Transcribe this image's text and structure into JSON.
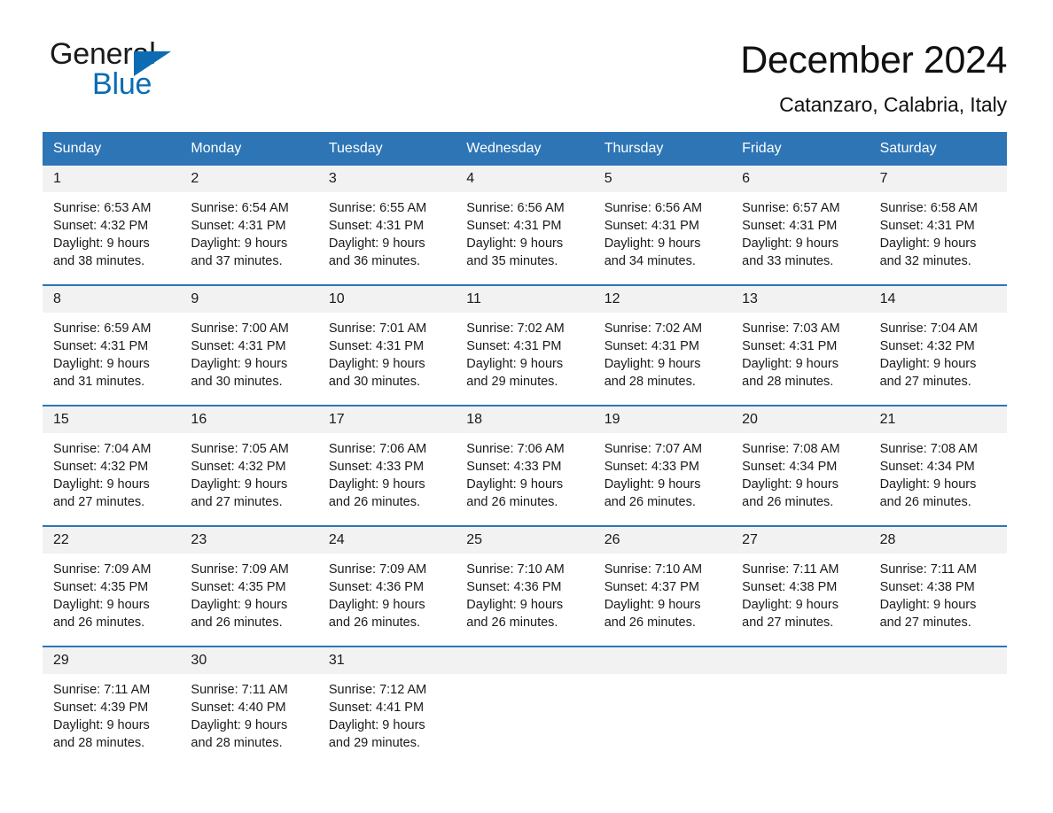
{
  "brand": {
    "name_top": "General",
    "name_bottom": "Blue",
    "accent_color": "#0b6cb3"
  },
  "header": {
    "title": "December 2024",
    "subtitle": "Catanzaro, Calabria, Italy"
  },
  "theme": {
    "header_blue": "#2e75b6",
    "daynum_bg": "#f2f2f2",
    "text": "#1a1a1a"
  },
  "weekdays": [
    "Sunday",
    "Monday",
    "Tuesday",
    "Wednesday",
    "Thursday",
    "Friday",
    "Saturday"
  ],
  "weeks": [
    [
      {
        "day": "1",
        "sunrise": "Sunrise: 6:53 AM",
        "sunset": "Sunset: 4:32 PM",
        "daylight_line1": "Daylight: 9 hours",
        "daylight_line2": "and 38 minutes."
      },
      {
        "day": "2",
        "sunrise": "Sunrise: 6:54 AM",
        "sunset": "Sunset: 4:31 PM",
        "daylight_line1": "Daylight: 9 hours",
        "daylight_line2": "and 37 minutes."
      },
      {
        "day": "3",
        "sunrise": "Sunrise: 6:55 AM",
        "sunset": "Sunset: 4:31 PM",
        "daylight_line1": "Daylight: 9 hours",
        "daylight_line2": "and 36 minutes."
      },
      {
        "day": "4",
        "sunrise": "Sunrise: 6:56 AM",
        "sunset": "Sunset: 4:31 PM",
        "daylight_line1": "Daylight: 9 hours",
        "daylight_line2": "and 35 minutes."
      },
      {
        "day": "5",
        "sunrise": "Sunrise: 6:56 AM",
        "sunset": "Sunset: 4:31 PM",
        "daylight_line1": "Daylight: 9 hours",
        "daylight_line2": "and 34 minutes."
      },
      {
        "day": "6",
        "sunrise": "Sunrise: 6:57 AM",
        "sunset": "Sunset: 4:31 PM",
        "daylight_line1": "Daylight: 9 hours",
        "daylight_line2": "and 33 minutes."
      },
      {
        "day": "7",
        "sunrise": "Sunrise: 6:58 AM",
        "sunset": "Sunset: 4:31 PM",
        "daylight_line1": "Daylight: 9 hours",
        "daylight_line2": "and 32 minutes."
      }
    ],
    [
      {
        "day": "8",
        "sunrise": "Sunrise: 6:59 AM",
        "sunset": "Sunset: 4:31 PM",
        "daylight_line1": "Daylight: 9 hours",
        "daylight_line2": "and 31 minutes."
      },
      {
        "day": "9",
        "sunrise": "Sunrise: 7:00 AM",
        "sunset": "Sunset: 4:31 PM",
        "daylight_line1": "Daylight: 9 hours",
        "daylight_line2": "and 30 minutes."
      },
      {
        "day": "10",
        "sunrise": "Sunrise: 7:01 AM",
        "sunset": "Sunset: 4:31 PM",
        "daylight_line1": "Daylight: 9 hours",
        "daylight_line2": "and 30 minutes."
      },
      {
        "day": "11",
        "sunrise": "Sunrise: 7:02 AM",
        "sunset": "Sunset: 4:31 PM",
        "daylight_line1": "Daylight: 9 hours",
        "daylight_line2": "and 29 minutes."
      },
      {
        "day": "12",
        "sunrise": "Sunrise: 7:02 AM",
        "sunset": "Sunset: 4:31 PM",
        "daylight_line1": "Daylight: 9 hours",
        "daylight_line2": "and 28 minutes."
      },
      {
        "day": "13",
        "sunrise": "Sunrise: 7:03 AM",
        "sunset": "Sunset: 4:31 PM",
        "daylight_line1": "Daylight: 9 hours",
        "daylight_line2": "and 28 minutes."
      },
      {
        "day": "14",
        "sunrise": "Sunrise: 7:04 AM",
        "sunset": "Sunset: 4:32 PM",
        "daylight_line1": "Daylight: 9 hours",
        "daylight_line2": "and 27 minutes."
      }
    ],
    [
      {
        "day": "15",
        "sunrise": "Sunrise: 7:04 AM",
        "sunset": "Sunset: 4:32 PM",
        "daylight_line1": "Daylight: 9 hours",
        "daylight_line2": "and 27 minutes."
      },
      {
        "day": "16",
        "sunrise": "Sunrise: 7:05 AM",
        "sunset": "Sunset: 4:32 PM",
        "daylight_line1": "Daylight: 9 hours",
        "daylight_line2": "and 27 minutes."
      },
      {
        "day": "17",
        "sunrise": "Sunrise: 7:06 AM",
        "sunset": "Sunset: 4:33 PM",
        "daylight_line1": "Daylight: 9 hours",
        "daylight_line2": "and 26 minutes."
      },
      {
        "day": "18",
        "sunrise": "Sunrise: 7:06 AM",
        "sunset": "Sunset: 4:33 PM",
        "daylight_line1": "Daylight: 9 hours",
        "daylight_line2": "and 26 minutes."
      },
      {
        "day": "19",
        "sunrise": "Sunrise: 7:07 AM",
        "sunset": "Sunset: 4:33 PM",
        "daylight_line1": "Daylight: 9 hours",
        "daylight_line2": "and 26 minutes."
      },
      {
        "day": "20",
        "sunrise": "Sunrise: 7:08 AM",
        "sunset": "Sunset: 4:34 PM",
        "daylight_line1": "Daylight: 9 hours",
        "daylight_line2": "and 26 minutes."
      },
      {
        "day": "21",
        "sunrise": "Sunrise: 7:08 AM",
        "sunset": "Sunset: 4:34 PM",
        "daylight_line1": "Daylight: 9 hours",
        "daylight_line2": "and 26 minutes."
      }
    ],
    [
      {
        "day": "22",
        "sunrise": "Sunrise: 7:09 AM",
        "sunset": "Sunset: 4:35 PM",
        "daylight_line1": "Daylight: 9 hours",
        "daylight_line2": "and 26 minutes."
      },
      {
        "day": "23",
        "sunrise": "Sunrise: 7:09 AM",
        "sunset": "Sunset: 4:35 PM",
        "daylight_line1": "Daylight: 9 hours",
        "daylight_line2": "and 26 minutes."
      },
      {
        "day": "24",
        "sunrise": "Sunrise: 7:09 AM",
        "sunset": "Sunset: 4:36 PM",
        "daylight_line1": "Daylight: 9 hours",
        "daylight_line2": "and 26 minutes."
      },
      {
        "day": "25",
        "sunrise": "Sunrise: 7:10 AM",
        "sunset": "Sunset: 4:36 PM",
        "daylight_line1": "Daylight: 9 hours",
        "daylight_line2": "and 26 minutes."
      },
      {
        "day": "26",
        "sunrise": "Sunrise: 7:10 AM",
        "sunset": "Sunset: 4:37 PM",
        "daylight_line1": "Daylight: 9 hours",
        "daylight_line2": "and 26 minutes."
      },
      {
        "day": "27",
        "sunrise": "Sunrise: 7:11 AM",
        "sunset": "Sunset: 4:38 PM",
        "daylight_line1": "Daylight: 9 hours",
        "daylight_line2": "and 27 minutes."
      },
      {
        "day": "28",
        "sunrise": "Sunrise: 7:11 AM",
        "sunset": "Sunset: 4:38 PM",
        "daylight_line1": "Daylight: 9 hours",
        "daylight_line2": "and 27 minutes."
      }
    ],
    [
      {
        "day": "29",
        "sunrise": "Sunrise: 7:11 AM",
        "sunset": "Sunset: 4:39 PM",
        "daylight_line1": "Daylight: 9 hours",
        "daylight_line2": "and 28 minutes."
      },
      {
        "day": "30",
        "sunrise": "Sunrise: 7:11 AM",
        "sunset": "Sunset: 4:40 PM",
        "daylight_line1": "Daylight: 9 hours",
        "daylight_line2": "and 28 minutes."
      },
      {
        "day": "31",
        "sunrise": "Sunrise: 7:12 AM",
        "sunset": "Sunset: 4:41 PM",
        "daylight_line1": "Daylight: 9 hours",
        "daylight_line2": "and 29 minutes."
      },
      {
        "day": "",
        "sunrise": "",
        "sunset": "",
        "daylight_line1": "",
        "daylight_line2": ""
      },
      {
        "day": "",
        "sunrise": "",
        "sunset": "",
        "daylight_line1": "",
        "daylight_line2": ""
      },
      {
        "day": "",
        "sunrise": "",
        "sunset": "",
        "daylight_line1": "",
        "daylight_line2": ""
      },
      {
        "day": "",
        "sunrise": "",
        "sunset": "",
        "daylight_line1": "",
        "daylight_line2": ""
      }
    ]
  ]
}
